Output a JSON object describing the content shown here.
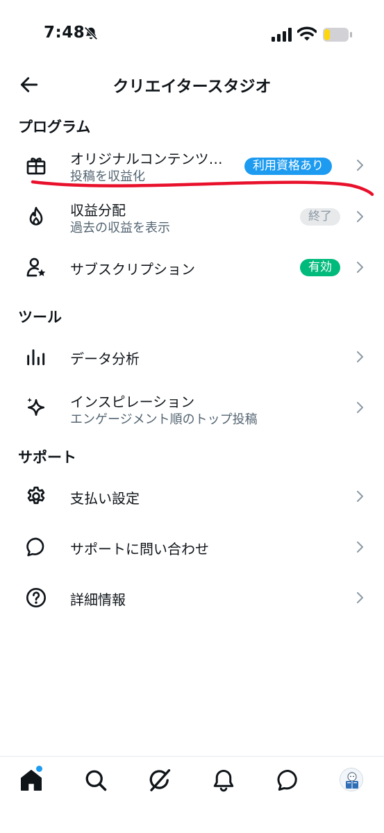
{
  "status_bar": {
    "time": "7:48",
    "icons": [
      "bell-slash-icon",
      "cellular-signal-icon",
      "wifi-icon",
      "battery-icon"
    ]
  },
  "header": {
    "title": "クリエイタースタジオ",
    "back_icon": "arrow-left-icon"
  },
  "sections": [
    {
      "title": "プログラム",
      "items": [
        {
          "icon": "gift-icon",
          "title": "オリジナルコンテンツ…",
          "subtitle": "投稿を収益化",
          "badge": "利用資格あり",
          "badge_color": "#1d9bf0",
          "badge_text_color": "#ffffff"
        },
        {
          "icon": "flame-icon",
          "title": "収益分配",
          "subtitle": "過去の収益を表示",
          "badge": "終了",
          "badge_color": "#e7e9ea",
          "badge_text_color": "#8b98a5"
        },
        {
          "icon": "person-star-icon",
          "title": "サブスクリプション",
          "badge": "有効",
          "badge_color": "#00ba7c",
          "badge_text_color": "#ffffff"
        }
      ]
    },
    {
      "title": "ツール",
      "items": [
        {
          "icon": "bar-chart-icon",
          "title": "データ分析"
        },
        {
          "icon": "sparkle-icon",
          "title": "インスピレーション",
          "subtitle": "エンゲージメント順のトップ投稿"
        }
      ]
    },
    {
      "title": "サポート",
      "items": [
        {
          "icon": "gear-icon",
          "title": "支払い設定"
        },
        {
          "icon": "chat-bubble-icon",
          "title": "サポートに問い合わせ"
        },
        {
          "icon": "question-circle-icon",
          "title": "詳細情報"
        }
      ]
    }
  ],
  "annotation": {
    "color": "#e8102b"
  },
  "bottom_nav": {
    "items": [
      "home-icon",
      "search-icon",
      "grok-icon",
      "notifications-bell-icon",
      "messages-icon",
      "profile-avatar"
    ],
    "notification_dot_color": "#1d9bf0"
  }
}
